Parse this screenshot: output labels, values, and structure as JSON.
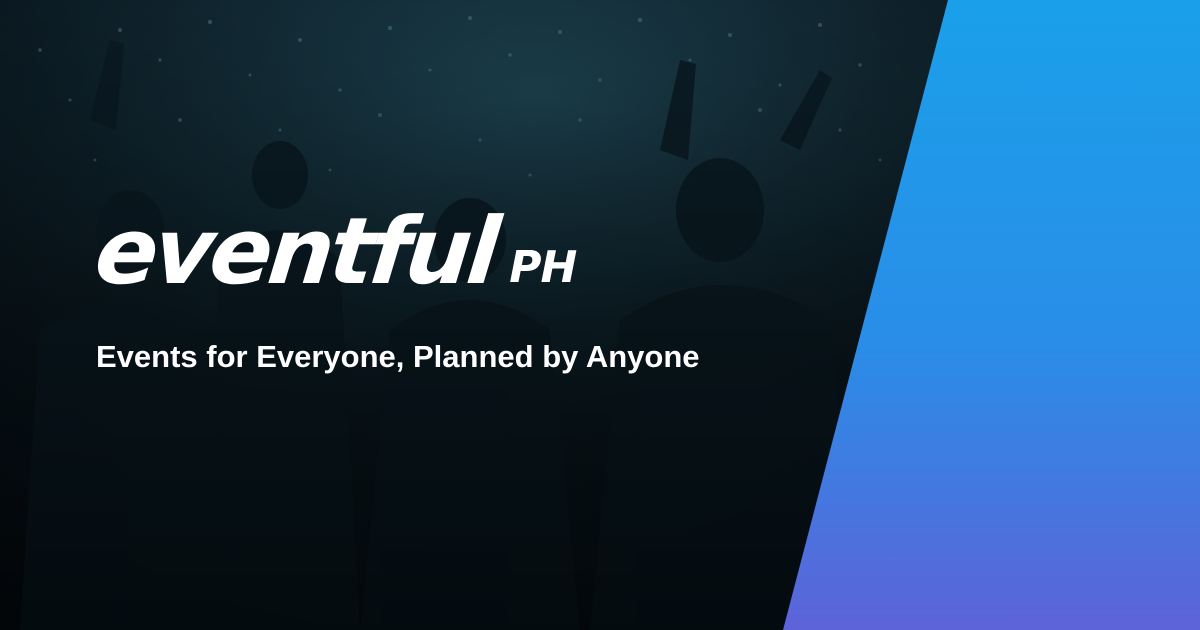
{
  "brand": {
    "wordmark": "eventful",
    "suffix": "PH"
  },
  "tagline": "Events for Everyone, Planned by Anyone",
  "colors": {
    "background_dark": "#071018",
    "wedge_top": "#1aa0ea",
    "wedge_mid": "#2a8de8",
    "wedge_bottom": "#5d63d8",
    "text": "#ffffff"
  },
  "background_image": "crowd-at-concert-icon"
}
